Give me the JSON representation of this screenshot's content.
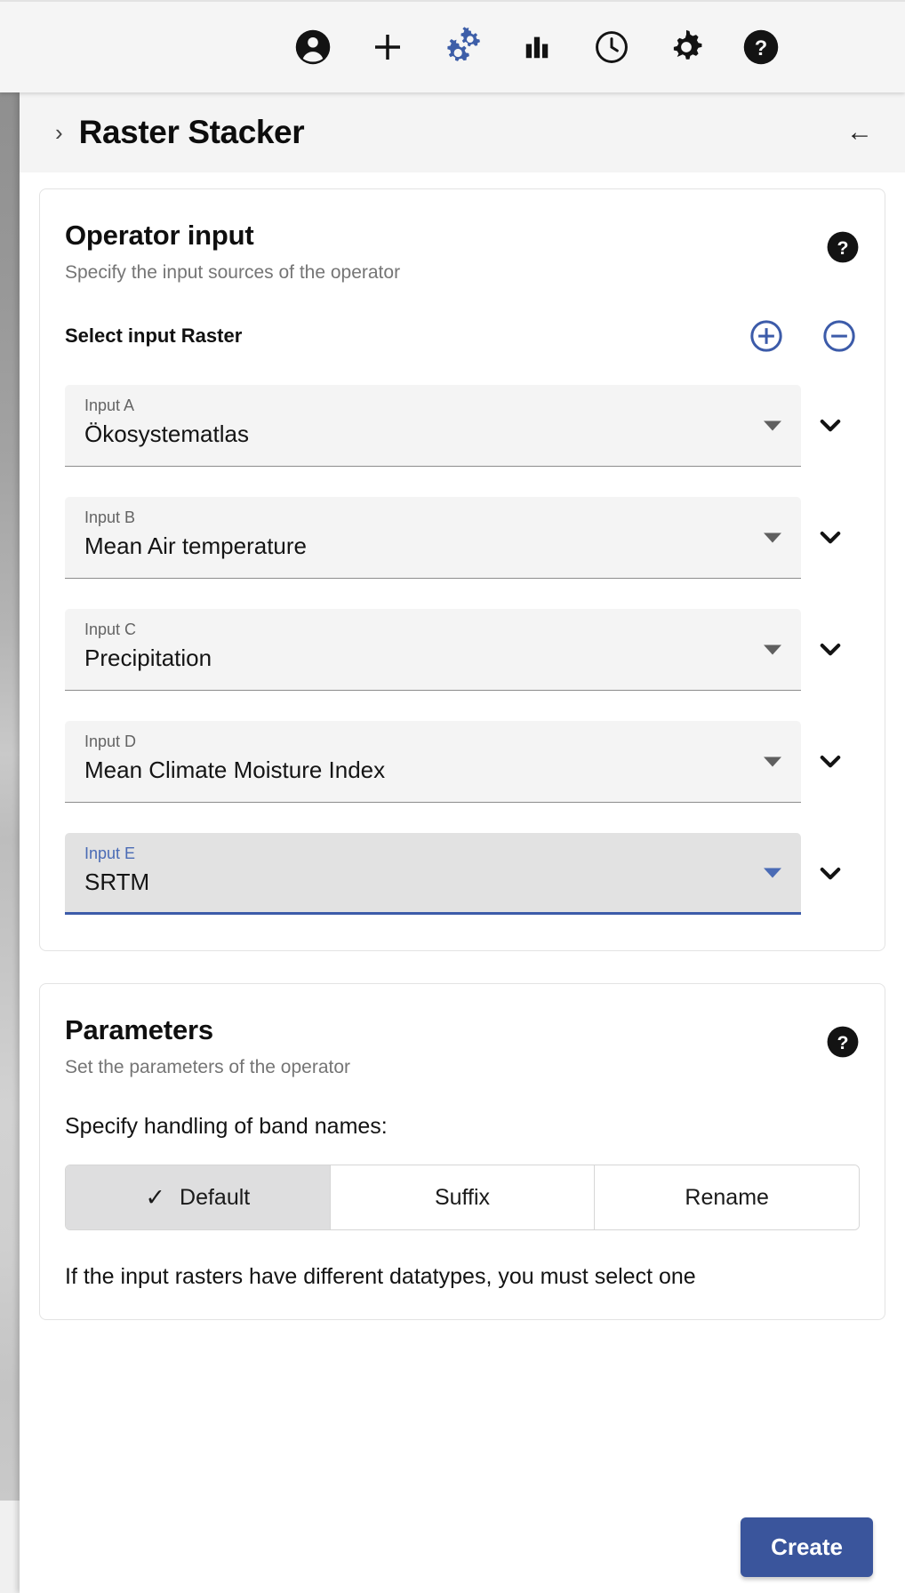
{
  "toolbar": {
    "icons": [
      {
        "name": "account-icon",
        "label": "Account",
        "glyph": "account"
      },
      {
        "name": "add-icon",
        "label": "Add",
        "glyph": "plus"
      },
      {
        "name": "operators-icon",
        "label": "Operators",
        "glyph": "gears"
      },
      {
        "name": "plots-icon",
        "label": "Plots",
        "glyph": "bars"
      },
      {
        "name": "history-icon",
        "label": "History",
        "glyph": "clock"
      },
      {
        "name": "settings-icon",
        "label": "Settings",
        "glyph": "gear"
      },
      {
        "name": "help-icon",
        "label": "Help",
        "glyph": "question"
      }
    ],
    "active_icon_color": "#3d5ea8",
    "icon_color": "#131313"
  },
  "panel": {
    "breadcrumb_chevron": "›",
    "title": "Raster Stacker",
    "back_arrow": "←"
  },
  "operator_input": {
    "title": "Operator input",
    "subtitle": "Specify the input sources of the operator",
    "help_label": "?",
    "select_label": "Select input Raster",
    "add_label": "+",
    "remove_label": "−",
    "accent": "#3c5ba9",
    "inputs": [
      {
        "label": "Input A",
        "value": "Ökosystematlas",
        "focused": false
      },
      {
        "label": "Input B",
        "value": "Mean Air temperature",
        "focused": false
      },
      {
        "label": "Input C",
        "value": "Precipitation",
        "focused": false
      },
      {
        "label": "Input D",
        "value": "Mean Climate Moisture Index",
        "focused": false
      },
      {
        "label": "Input E",
        "value": "SRTM",
        "focused": true
      }
    ]
  },
  "parameters": {
    "title": "Parameters",
    "subtitle": "Set the parameters of the operator",
    "help_label": "?",
    "band_names_label": "Specify handling of band names:",
    "band_name_options": [
      {
        "label": "Default",
        "selected": true,
        "check": "✓"
      },
      {
        "label": "Suffix",
        "selected": false,
        "check": ""
      },
      {
        "label": "Rename",
        "selected": false,
        "check": ""
      }
    ],
    "datatype_note": "If the input rasters have different datatypes, you must select one"
  },
  "footer": {
    "create_label": "Create",
    "create_color": "#3a559c"
  }
}
